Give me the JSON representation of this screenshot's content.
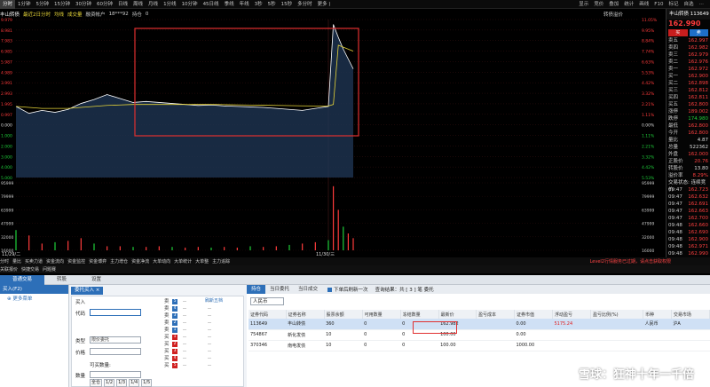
{
  "topbar": {
    "tabs": [
      "分时",
      "1分钟",
      "5分钟",
      "15分钟",
      "30分钟",
      "60分钟",
      "日线",
      "周线",
      "月线",
      "1分线",
      "10分钟",
      "45日线",
      "季线",
      "年线",
      "3秒",
      "5秒",
      "15秒",
      "多分时",
      "更多 ⟩"
    ],
    "right": [
      "显示",
      "竞价",
      "叠加",
      "统计",
      "画线",
      "F10",
      "标记",
      "自选",
      "⋯"
    ],
    "active_index": 0
  },
  "infobar": {
    "name": "丰山转债",
    "range": "最近2日分时",
    "series_a": "均线",
    "series_b": "成交量",
    "account": "融资帐户",
    "account_val": "18***92",
    "position": "持仓",
    "position_val": "0",
    "right_label": "转债溢价"
  },
  "quote": {
    "code": "丰山转债 113649",
    "price": "162.990",
    "buy_label": "买",
    "sell_label": "卖",
    "asks": [
      {
        "label": "卖五",
        "price": "162.997"
      },
      {
        "label": "卖四",
        "price": "162.982"
      },
      {
        "label": "卖三",
        "price": "162.979"
      },
      {
        "label": "卖二",
        "price": "162.976"
      },
      {
        "label": "卖一",
        "price": "162.972"
      }
    ],
    "bids": [
      {
        "label": "买一",
        "price": "162.900"
      },
      {
        "label": "买二",
        "price": "162.898"
      },
      {
        "label": "买三",
        "price": "162.812"
      },
      {
        "label": "买四",
        "price": "162.811"
      },
      {
        "label": "买五",
        "price": "162.800"
      }
    ],
    "stats": [
      {
        "label": "涨停",
        "val": "189.002",
        "c": "r"
      },
      {
        "label": "跌停",
        "val": "174.980",
        "c": "g"
      },
      {
        "label": "最低",
        "val": "162.800",
        "c": "r"
      },
      {
        "label": "今开",
        "val": "162.800",
        "c": "r"
      },
      {
        "label": "量比",
        "val": "4.87",
        "c": "w"
      },
      {
        "label": "总量",
        "val": "522362",
        "c": "w"
      },
      {
        "label": "外盘",
        "val": "162.000",
        "c": "r"
      },
      {
        "label": "正股价",
        "val": "20.76",
        "c": "r"
      },
      {
        "label": "转股价",
        "val": "13.80",
        "c": "w"
      },
      {
        "label": "溢价率",
        "val": "8.29%",
        "c": "r"
      }
    ],
    "ticks_title": "交易状态: 连续竞价",
    "ticks": [
      {
        "t": "09:47",
        "p": "162.723"
      },
      {
        "t": "09:47",
        "p": "162.632"
      },
      {
        "t": "09:47",
        "p": "162.691"
      },
      {
        "t": "09:47",
        "p": "162.663"
      },
      {
        "t": "09:47",
        "p": "162.700"
      },
      {
        "t": "09:48",
        "p": "162.660"
      },
      {
        "t": "09:48",
        "p": "162.690"
      },
      {
        "t": "09:48",
        "p": "162.900"
      },
      {
        "t": "09:48",
        "p": "162.971"
      },
      {
        "t": "09:48",
        "p": "162.990"
      }
    ]
  },
  "funcbar": {
    "items": [
      "分时",
      "量比",
      "买卖力道",
      "资金流向",
      "资金监控",
      "资金博弈",
      "主力增仓",
      "资金净流",
      "大单动向",
      "大单统计",
      "大单整",
      "主力追踪"
    ],
    "warn": "Level2行情服务已过期，请点击获取权限"
  },
  "funcbar2": {
    "items": [
      "关联报价",
      "快捷交易",
      "问题赛"
    ]
  },
  "trade": {
    "tabs": [
      "普通交易",
      "转股",
      "设置"
    ],
    "left_head": "买入(F2)",
    "left_item": "⊕ 更多菜单",
    "order_tab": "委托买入 ×",
    "buy_title": "买入",
    "code_label": "代码",
    "type_label": "类型",
    "type_value": "限价委托",
    "price_label": "价格",
    "avail_label": "可买数量:",
    "qty_label": "数量",
    "qty_buttons": [
      "全仓",
      "1/2",
      "1/3",
      "1/4",
      "1/5"
    ],
    "five_levels": "刷新五档",
    "book": [
      {
        "l": "卖",
        "i": "5",
        "v": "--",
        "q": "--"
      },
      {
        "l": "卖",
        "i": "4",
        "v": "--",
        "q": "--"
      },
      {
        "l": "卖",
        "i": "3",
        "v": "--",
        "q": "--"
      },
      {
        "l": "卖",
        "i": "2",
        "v": "--",
        "q": "--"
      },
      {
        "l": "卖",
        "i": "1",
        "v": "--",
        "q": "--"
      },
      {
        "l": "买",
        "i": "1",
        "v": "--",
        "q": "--"
      },
      {
        "l": "买",
        "i": "2",
        "v": "--",
        "q": "--"
      },
      {
        "l": "买",
        "i": "3",
        "v": "--",
        "q": "--"
      },
      {
        "l": "买",
        "i": "4",
        "v": "--",
        "q": "--"
      },
      {
        "l": "买",
        "i": "5",
        "v": "--",
        "q": "--"
      }
    ]
  },
  "positions": {
    "tabs": [
      "持仓",
      "当日委托",
      "当日成交"
    ],
    "check_label": "下单后刷新一次",
    "query_label": "查询结果：共 [ 3 ] 笔 委托",
    "currency": "人民币",
    "columns": [
      "证券代码",
      "证券名称",
      "股票余额",
      "可用数量",
      "冻结数量",
      "最新价",
      "盈亏成本",
      "证券市值",
      "浮动盈亏",
      "盈亏比例(%)",
      "币种",
      "交易市场"
    ],
    "rows": [
      [
        "113649",
        "丰山转债",
        "360",
        "0",
        "0",
        "162.982",
        "",
        "0.00",
        "5175.24",
        "",
        "人民币",
        "沪A"
      ],
      [
        "754867",
        "新化发债",
        "10",
        "0",
        "0",
        "100.00",
        "",
        "0.00",
        "",
        "",
        "",
        ""
      ],
      [
        "370346",
        "南电发债",
        "10",
        "0",
        "0",
        "100.00",
        "",
        "1000.00",
        "",
        "",
        "",
        ""
      ]
    ]
  },
  "watermark": "雪球：狂神十年一千倍",
  "colors": {
    "up": "#ff3b3b",
    "down": "#1fcf3a",
    "avg": "#e6d438",
    "price": "#ffffff",
    "accent": "#2d6fb8"
  },
  "chart_data": {
    "type": "line",
    "title": "丰山转债",
    "x_labels": [
      "11/29/二",
      "11/30/三"
    ],
    "y_ticks_left_price": [
      "9.979",
      "8.981",
      "7.983",
      "6.985",
      "5.987",
      "4.989",
      "3.991",
      "2.993",
      "1.995",
      "0.997",
      "0.000",
      "1.000",
      "2.000",
      "3.000",
      "4.000",
      "5.000"
    ],
    "y_ticks_right_pct": [
      "11.05%",
      "9.95%",
      "8.84%",
      "7.74%",
      "6.63%",
      "5.53%",
      "4.42%",
      "3.32%",
      "2.21%",
      "1.11%",
      "0.00%",
      "1.11%",
      "2.21%",
      "3.32%",
      "4.42%",
      "5.53%"
    ],
    "volume_ticks": [
      "95999",
      "79999",
      "63999",
      "47999",
      "32000",
      "16000"
    ],
    "series": [
      {
        "name": "价格",
        "values": [
          2.2,
          1.5,
          1.8,
          1.6,
          1.9,
          2.5,
          2.9,
          3.4,
          3.0,
          2.6,
          2.7,
          2.6,
          2.5,
          2.4,
          2.3,
          2.35,
          2.25,
          2.2,
          2.15,
          2.1,
          2.0,
          1.9,
          1.8,
          2.0,
          2.2,
          10.5,
          9.2,
          8.0,
          7.0,
          6.0
        ]
      },
      {
        "name": "均价",
        "values": [
          2.2,
          2.1,
          2.0,
          2.0,
          2.0,
          2.1,
          2.2,
          2.3,
          2.35,
          2.4,
          2.4,
          2.4,
          2.4,
          2.4,
          2.4,
          2.4,
          2.38,
          2.36,
          2.34,
          2.32,
          2.3,
          2.28,
          2.26,
          2.25,
          2.25,
          2.4,
          8.4,
          8.2,
          8.0,
          7.8
        ]
      }
    ],
    "volume": [
      30,
      22,
      10,
      12,
      14,
      18,
      10,
      6,
      6,
      5,
      5,
      6,
      5,
      4,
      5,
      4,
      5,
      4,
      6,
      5,
      6,
      8,
      10,
      12,
      15,
      95,
      60,
      35,
      25,
      18
    ],
    "ylim": [
      -5,
      11
    ],
    "grid": true
  }
}
